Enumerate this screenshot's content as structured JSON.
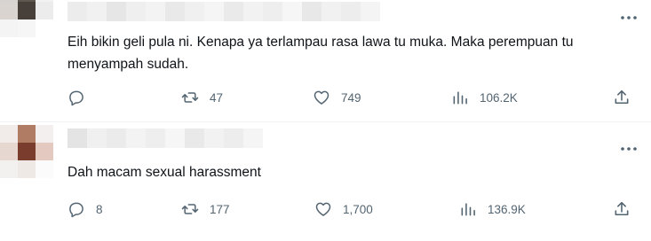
{
  "colors": {
    "text_primary": "#0f1419",
    "text_secondary": "#536471",
    "divider": "#eff3f4",
    "background": "#ffffff"
  },
  "tweets": [
    {
      "text": "Eih bikin geli pula ni. Kenapa ya terlampau rasa lawa tu muka. Maka perempuan tu menyampah sudah.",
      "replies": "",
      "retweets": "47",
      "likes": "749",
      "views": "106.2K"
    },
    {
      "text": "Dah macam sexual harassment",
      "replies": "8",
      "retweets": "177",
      "likes": "1,700",
      "views": "136.9K"
    }
  ],
  "icons": {
    "more": "more-horizontal-icon",
    "reply": "reply-icon",
    "retweet": "retweet-icon",
    "like": "heart-icon",
    "views": "views-chart-icon",
    "share": "share-icon"
  }
}
